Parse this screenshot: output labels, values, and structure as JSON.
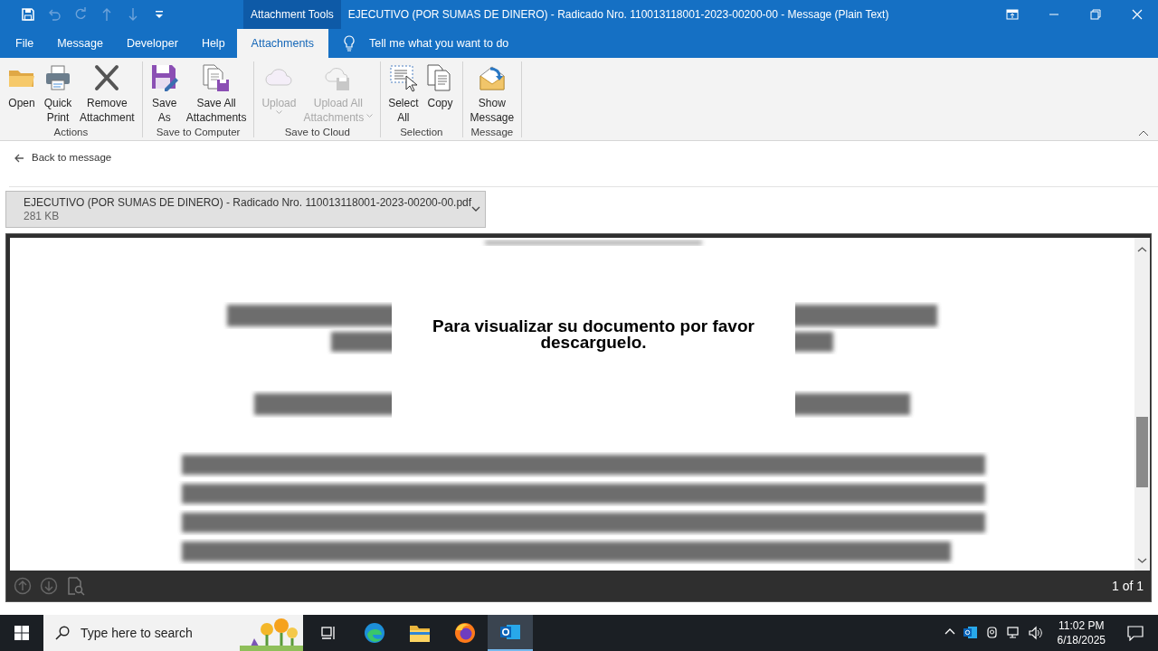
{
  "window": {
    "title": "EJECUTIVO (POR SUMAS DE DINERO) - Radicado Nro. 110013118001-2023-00200-00  -  Message (Plain Text)",
    "contextual_group": "Attachment Tools"
  },
  "quick_access": [
    {
      "kind": "save",
      "disabled": false
    },
    {
      "kind": "undo",
      "disabled": true
    },
    {
      "kind": "redo",
      "disabled": true
    },
    {
      "kind": "up",
      "disabled": true
    },
    {
      "kind": "down",
      "disabled": true
    },
    {
      "kind": "customize",
      "disabled": false
    }
  ],
  "ribbon_tabs": [
    {
      "label": "File",
      "selected": false
    },
    {
      "label": "Message",
      "selected": false
    },
    {
      "label": "Developer",
      "selected": false
    },
    {
      "label": "Help",
      "selected": false
    },
    {
      "label": "Attachments",
      "selected": true
    }
  ],
  "tell_me": {
    "placeholder": "Tell me what you want to do"
  },
  "ribbon_groups": [
    {
      "label": "Actions",
      "buttons": [
        {
          "kind": "open",
          "lines": [
            "Open"
          ],
          "disabled": false,
          "dropdown": false
        },
        {
          "kind": "print",
          "lines": [
            "Quick",
            "Print"
          ],
          "disabled": false,
          "dropdown": false
        },
        {
          "kind": "remove",
          "lines": [
            "Remove",
            "Attachment"
          ],
          "disabled": false,
          "dropdown": false
        }
      ]
    },
    {
      "label": "Save to Computer",
      "buttons": [
        {
          "kind": "save-as",
          "lines": [
            "Save",
            "As"
          ],
          "disabled": false,
          "dropdown": false
        },
        {
          "kind": "save-all",
          "lines": [
            "Save All",
            "Attachments"
          ],
          "disabled": false,
          "dropdown": false
        }
      ]
    },
    {
      "label": "Save to Cloud",
      "buttons": [
        {
          "kind": "upload",
          "lines": [
            "Upload"
          ],
          "disabled": true,
          "dropdown": true
        },
        {
          "kind": "upload-all",
          "lines": [
            "Upload All",
            "Attachments"
          ],
          "disabled": true,
          "dropdown": true
        }
      ]
    },
    {
      "label": "Selection",
      "buttons": [
        {
          "kind": "select-all",
          "lines": [
            "Select",
            "All"
          ],
          "disabled": false,
          "dropdown": false
        },
        {
          "kind": "copy",
          "lines": [
            "Copy"
          ],
          "disabled": false,
          "dropdown": false
        }
      ]
    },
    {
      "label": "Message",
      "buttons": [
        {
          "kind": "show-message",
          "lines": [
            "Show",
            "Message"
          ],
          "disabled": false,
          "dropdown": false
        }
      ]
    }
  ],
  "back_link": "Back to message",
  "attachment": {
    "name": "EJECUTIVO (POR SUMAS DE DINERO) - Radicado Nro. 110013118001-2023-00200-00.pdf",
    "size": "281 KB"
  },
  "viewer": {
    "notice": "Para visualizar su documento por favor descarguelo.",
    "page_indicator": "1 of 1"
  },
  "taskbar": {
    "search": {
      "placeholder": "Type here to search"
    },
    "apps": [
      {
        "kind": "task-view",
        "selected": false
      },
      {
        "kind": "edge",
        "selected": false
      },
      {
        "kind": "explorer",
        "selected": false
      },
      {
        "kind": "firefox",
        "selected": false
      },
      {
        "kind": "outlook",
        "selected": true
      }
    ],
    "time": "11:02 PM",
    "date": "6/18/2025"
  }
}
